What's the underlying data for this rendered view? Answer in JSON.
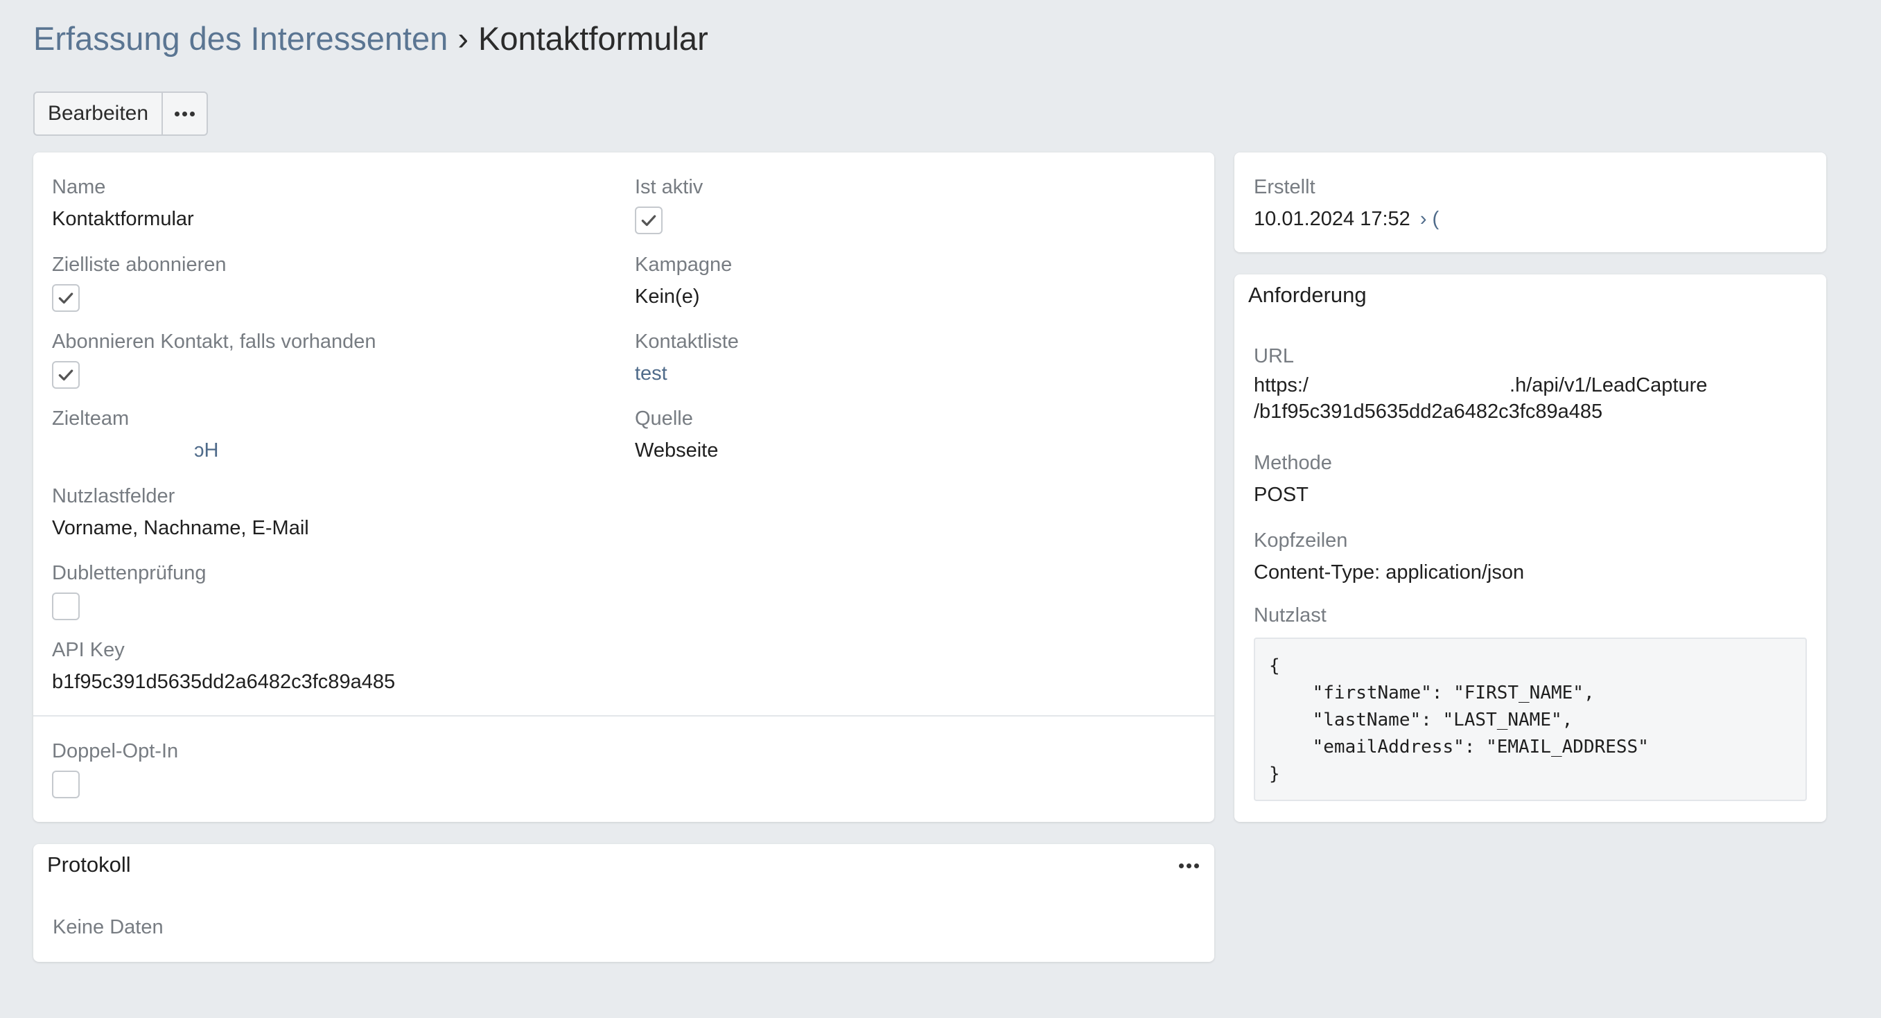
{
  "breadcrumb": {
    "parent": "Erfassung des Interessenten",
    "separator": "›",
    "current": "Kontaktformular"
  },
  "toolbar": {
    "edit_label": "Bearbeiten",
    "more_icon": "ellipsis-icon"
  },
  "main": {
    "fields": {
      "name": {
        "label": "Name",
        "value": "Kontaktformular"
      },
      "is_active": {
        "label": "Ist aktiv",
        "checked": true
      },
      "subscribe_target_list": {
        "label": "Zielliste abonnieren",
        "checked": true
      },
      "campaign": {
        "label": "Kampagne",
        "value": "Kein(e)"
      },
      "subscribe_contact": {
        "label": "Abonnieren Kontakt, falls vorhanden",
        "checked": true
      },
      "contact_list": {
        "label": "Kontaktliste",
        "value": "test"
      },
      "target_team": {
        "label": "Zielteam",
        "value": "ɔH"
      },
      "source": {
        "label": "Quelle",
        "value": "Webseite"
      },
      "payload_fields": {
        "label": "Nutzlastfelder",
        "value": "Vorname, Nachname, E-Mail"
      },
      "duplicate_check": {
        "label": "Dublettenprüfung",
        "checked": false
      },
      "api_key": {
        "label": "API Key",
        "value": "b1f95c391d5635dd2a6482c3fc89a485"
      },
      "double_opt_in": {
        "label": "Doppel-Opt-In",
        "checked": false
      }
    }
  },
  "created": {
    "label": "Erstellt",
    "value": "10.01.2024 17:52",
    "user_prefix": "› ("
  },
  "request": {
    "title": "Anforderung",
    "url": {
      "label": "URL",
      "line1": "https:/                                    .h/api/v1/LeadCapture",
      "line2": "/b1f95c391d5635dd2a6482c3fc89a485"
    },
    "method": {
      "label": "Methode",
      "value": "POST"
    },
    "headers": {
      "label": "Kopfzeilen",
      "value": "Content-Type: application/json"
    },
    "payload": {
      "label": "Nutzlast",
      "code": "{\n    \"firstName\": \"FIRST_NAME\",\n    \"lastName\": \"LAST_NAME\",\n    \"emailAddress\": \"EMAIL_ADDRESS\"\n}"
    }
  },
  "log": {
    "title": "Protokoll",
    "empty_text": "Keine Daten",
    "menu_icon": "ellipsis-icon"
  }
}
